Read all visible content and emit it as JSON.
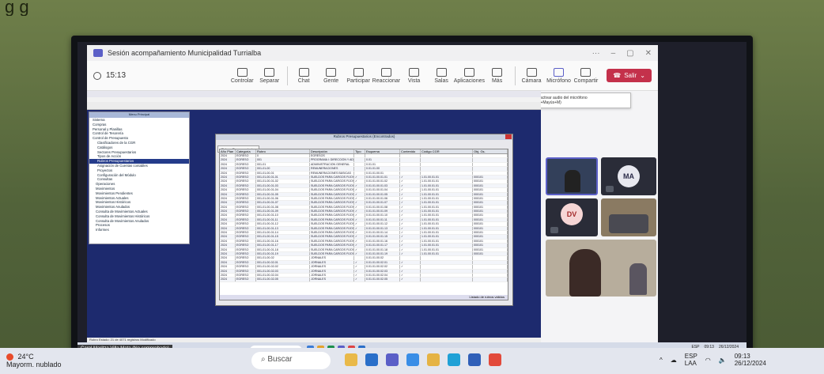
{
  "caption": "g g",
  "teams": {
    "window_title": "Sesión acompañamiento Municipalidad Turrialba",
    "timer": "15:13",
    "toolbar": [
      {
        "label": "Controlar",
        "icon": "remote-control-icon"
      },
      {
        "label": "Separar",
        "icon": "pop-out-icon"
      },
      {
        "label": "Chat",
        "icon": "chat-icon"
      },
      {
        "label": "Gente",
        "icon": "people-icon",
        "count": "3"
      },
      {
        "label": "Participar",
        "icon": "hand-icon"
      },
      {
        "label": "Reaccionar",
        "icon": "reaction-icon"
      },
      {
        "label": "Vista",
        "icon": "view-icon"
      },
      {
        "label": "Salas",
        "icon": "rooms-icon"
      },
      {
        "label": "Aplicaciones",
        "icon": "apps-icon"
      },
      {
        "label": "Más",
        "icon": "more-icon"
      },
      {
        "label": "Cámara",
        "icon": "camera-icon"
      },
      {
        "label": "Micrófono",
        "icon": "microphone-icon"
      },
      {
        "label": "Compartir",
        "icon": "share-icon"
      }
    ],
    "leave_label": "Salir",
    "tooltip": {
      "line1": "Desactivar audio del micrófono",
      "line2": "(Ctrl+Mayús+M)"
    },
    "participants": [
      {
        "initials": "MA",
        "color": "#e8e8f0",
        "text_color": "#2c2c4a"
      },
      {
        "initials": "DV",
        "color": "#f6d6d6",
        "text_color": "#a32b2b"
      }
    ],
    "presenter_name": "Carol Maritza Villa Mata (No comprobado)"
  },
  "erp": {
    "tree_title": "Menu Principal",
    "tree": [
      "Sistema",
      "Compras",
      "Personal y Planillas",
      "Control de Tesorería",
      "Control de Presupuesto",
      "Clasificadores de la CGR",
      "Catálogos",
      "Sectores Presupuestarios",
      "Tipos de Acción",
      "Rubros Presupuestarios",
      "Asignación de Cuentas contables",
      "Proyectos",
      "Configuración del Módulo",
      "Consultas",
      "Operaciones",
      "Movimientos",
      "Movimientos Pendientes",
      "Movimientos Actuales",
      "Movimientos Históricos",
      "Movimientos Anulados",
      "Consulta de Movimientos Actuales",
      "Consulta de Movimientos Históricos",
      "Consulta de Movimientos Anulados",
      "Procesos",
      "Informes"
    ],
    "tree_selected": 9,
    "dialog_title": "Rubros Presupuestarios (Encontrados)",
    "dialog_tab": "Rubros Presupuestarios",
    "columns": [
      "Año Plan",
      "Categoría",
      "Rubro",
      "Descripción",
      "Tipo",
      "Esquema",
      "Contenido",
      "Código CGR",
      "Obj. Gs."
    ],
    "rows": [
      [
        "2024",
        "EGRESO",
        "0",
        "EGRESOS",
        "",
        "",
        "",
        "",
        ""
      ],
      [
        "2024",
        "EGRESO",
        "001",
        "PROGRAMA I: DIRECCIÓN Y ADMIN",
        "",
        "0.01",
        "",
        "",
        ""
      ],
      [
        "2024",
        "EGRESO",
        "001-01",
        "ADMINISTRACIÓN GENERAL",
        "",
        "0.01.01",
        "",
        "",
        ""
      ],
      [
        "2024",
        "EGRESO",
        "001-01-00",
        "REMUNERACIONES",
        "",
        "0.01.01.00",
        "",
        "",
        ""
      ],
      [
        "2024",
        "EGRESO",
        "001-01-00-01",
        "REMUNERACIONES BÁSICAS",
        "",
        "0.01.01.00.01",
        "",
        "",
        ""
      ],
      [
        "2024",
        "EGRESO",
        "001-01-00-01-01",
        "SUELDOS PARA CARGOS FIJOS",
        "✓",
        "0.01.01.00.01.01",
        "✓",
        "1.01.00.01.01",
        "000101"
      ],
      [
        "2024",
        "EGRESO",
        "001-01-00-01-02",
        "SUELDOS PARA CARGOS FIJOS",
        "✓",
        "0.01.01.00.01.02",
        "✓",
        "1.01.00.01.01",
        "000101"
      ],
      [
        "2024",
        "EGRESO",
        "001-01-00-01-03",
        "SUELDOS PARA CARGOS FIJOS",
        "✓",
        "0.01.01.00.01.03",
        "✓",
        "1.01.00.01.01",
        "000101"
      ],
      [
        "2024",
        "EGRESO",
        "001-01-00-01-04",
        "SUELDOS PARA CARGOS FIJOS",
        "✓",
        "0.01.01.00.01.04",
        "✓",
        "1.01.00.01.01",
        "000101"
      ],
      [
        "2024",
        "EGRESO",
        "001-01-00-01-05",
        "SUELDOS PARA CARGOS FIJOS",
        "✓",
        "0.01.01.00.01.05",
        "✓",
        "1.01.00.01.01",
        "000101"
      ],
      [
        "2024",
        "EGRESO",
        "001-01-00-01-06",
        "SUELDOS PARA CARGOS FIJOS",
        "✓",
        "0.01.01.00.01.06",
        "✓",
        "1.01.00.01.01",
        "000101"
      ],
      [
        "2024",
        "EGRESO",
        "001-01-00-01-07",
        "SUELDOS PARA CARGOS FIJOS",
        "✓",
        "0.01.01.00.01.07",
        "✓",
        "1.01.00.01.01",
        "000101"
      ],
      [
        "2024",
        "EGRESO",
        "001-01-00-01-08",
        "SUELDOS PARA CARGOS FIJOS",
        "✓",
        "0.01.01.00.01.08",
        "✓",
        "1.01.00.01.01",
        "000101"
      ],
      [
        "2024",
        "EGRESO",
        "001-01-00-01-09",
        "SUELDOS PARA CARGOS FIJOS",
        "✓",
        "0.01.01.00.01.09",
        "✓",
        "1.01.00.01.01",
        "000101"
      ],
      [
        "2024",
        "EGRESO",
        "001-01-00-01-10",
        "SUELDOS PARA CARGOS FIJOS",
        "✓",
        "0.01.01.00.01.10",
        "✓",
        "1.01.00.01.01",
        "000101"
      ],
      [
        "2024",
        "EGRESO",
        "001-01-00-01-11",
        "SUELDOS PARA CARGOS FIJOS",
        "✓",
        "0.01.01.00.01.11",
        "✓",
        "1.01.00.01.01",
        "000101"
      ],
      [
        "2024",
        "EGRESO",
        "001-01-00-01-12",
        "SUELDOS PARA CARGOS FIJOS",
        "✓",
        "0.01.01.00.01.12",
        "✓",
        "1.01.00.01.01",
        "000101"
      ],
      [
        "2024",
        "EGRESO",
        "001-01-00-01-13",
        "SUELDOS PARA CARGOS FIJOS",
        "✓",
        "0.01.01.00.01.13",
        "✓",
        "1.01.00.01.01",
        "000101"
      ],
      [
        "2024",
        "EGRESO",
        "001-01-00-01-14",
        "SUELDOS PARA CARGOS FIJOS",
        "✓",
        "0.01.01.00.01.14",
        "✓",
        "1.01.00.01.01",
        "000101"
      ],
      [
        "2024",
        "EGRESO",
        "001-01-00-01-15",
        "SUELDOS PARA CARGOS FIJOS",
        "✓",
        "0.01.01.00.01.15",
        "✓",
        "1.01.00.01.01",
        "000101"
      ],
      [
        "2024",
        "EGRESO",
        "001-01-00-01-16",
        "SUELDOS PARA CARGOS FIJOS",
        "✓",
        "0.01.01.00.01.16",
        "✓",
        "1.01.00.01.01",
        "000101"
      ],
      [
        "2024",
        "EGRESO",
        "001-01-00-01-17",
        "SUELDOS PARA CARGOS FIJOS",
        "✓",
        "0.01.01.00.01.17",
        "✓",
        "1.01.00.01.01",
        "000101"
      ],
      [
        "2024",
        "EGRESO",
        "001-01-00-01-18",
        "SUELDOS PARA CARGOS FIJOS",
        "✓",
        "0.01.01.00.01.18",
        "✓",
        "1.01.00.01.01",
        "000101"
      ],
      [
        "2024",
        "EGRESO",
        "001-01-00-01-19",
        "SUELDOS PARA CARGOS FIJOS",
        "✓",
        "0.01.01.00.01.19",
        "✓",
        "1.01.00.01.01",
        "000101"
      ],
      [
        "2024",
        "EGRESO",
        "001-01-00-02",
        "JORNALES",
        "",
        "0.01.01.00.02",
        "",
        "",
        ""
      ],
      [
        "2024",
        "EGRESO",
        "001-01-00-02-01",
        "JORNALES",
        "✓",
        "0.01.01.00.02.01",
        "✓",
        "",
        ""
      ],
      [
        "2024",
        "EGRESO",
        "001-01-00-02-02",
        "JORNALES",
        "✓",
        "0.01.01.00.02.02",
        "✓",
        "",
        ""
      ],
      [
        "2024",
        "EGRESO",
        "001-01-00-02-03",
        "JORNALES",
        "✓",
        "0.01.01.00.02.03",
        "✓",
        "",
        ""
      ],
      [
        "2024",
        "EGRESO",
        "001-01-00-02-04",
        "JORNALES",
        "✓",
        "0.01.01.00.02.04",
        "✓",
        "",
        ""
      ],
      [
        "2024",
        "EGRESO",
        "001-01-00-02-05",
        "JORNALES",
        "✓",
        "0.01.01.00.02.05",
        "✓",
        "",
        ""
      ]
    ],
    "status": "Rubro Estado:  21 de 4071 registros   Modificado",
    "footer": "Listado de rubros válidos"
  },
  "inner_taskbar": {
    "search": "Buscar",
    "tray_lang": "ESP",
    "time": "09:13",
    "date": "26/12/2024"
  },
  "outer": {
    "weather_temp": "24°C",
    "weather_desc": "Mayorm. nublado",
    "search": "Buscar",
    "lang_top": "ESP",
    "lang_bottom": "LAA",
    "time": "09:13",
    "date": "26/12/2024"
  },
  "colors": {
    "teams_accent": "#5b5fc7",
    "leave_red": "#c4314b",
    "erp_desktop": "#1d2a6e"
  }
}
